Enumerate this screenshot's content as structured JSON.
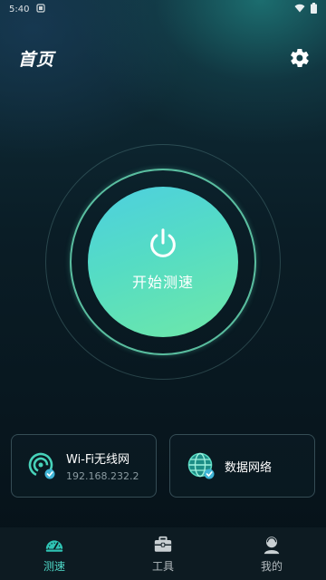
{
  "status_bar": {
    "time": "5:40"
  },
  "header": {
    "title": "首页"
  },
  "main": {
    "start_button_label": "开始测速"
  },
  "cards": [
    {
      "title": "Wi-Fi无线网",
      "subtitle": "192.168.232.2",
      "icon": "wifi-signal-icon"
    },
    {
      "title": "数据网络",
      "icon": "globe-icon"
    }
  ],
  "tabbar": {
    "tabs": [
      {
        "label": "测速",
        "icon": "speedometer-icon",
        "active": true
      },
      {
        "label": "工具",
        "icon": "toolbox-icon",
        "active": false
      },
      {
        "label": "我的",
        "icon": "profile-icon",
        "active": false
      }
    ]
  },
  "colors": {
    "accent": "#4fd8c8",
    "button_gradient_start": "#4dcfe0",
    "button_gradient_end": "#6ee8a8",
    "background": "#05121a"
  }
}
